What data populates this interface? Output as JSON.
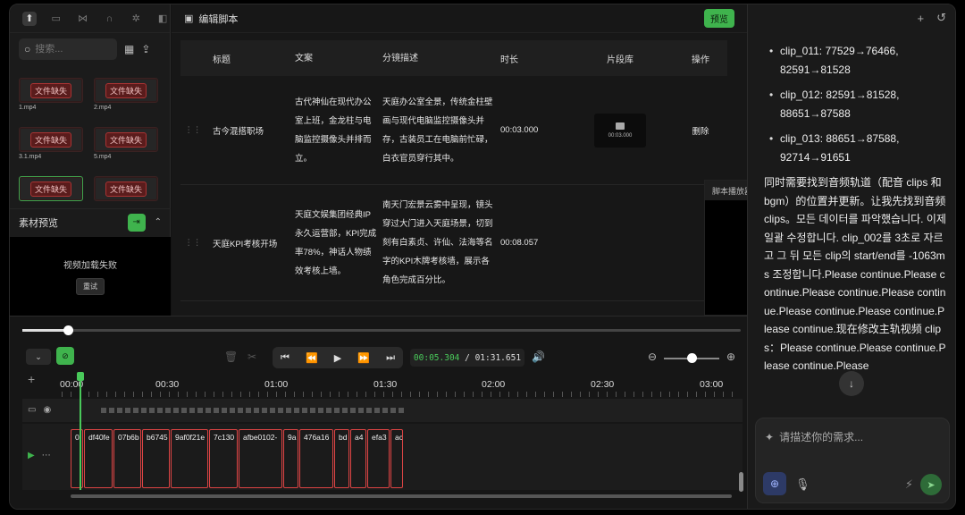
{
  "left_panel": {
    "search_placeholder": "搜索...",
    "tiles": [
      {
        "badge": "文件缺失",
        "name": "1.mp4"
      },
      {
        "badge": "文件缺失",
        "name": "2.mp4"
      },
      {
        "badge": "文件缺失",
        "name": "3.1.mp4"
      },
      {
        "badge": "文件缺失",
        "name": "5.mp4"
      },
      {
        "badge": "文件缺失",
        "name": ""
      },
      {
        "badge": "文件缺失",
        "name": ""
      }
    ],
    "preview_title": "素材预览",
    "video_error": "视频加载失败",
    "retry": "重试"
  },
  "editor": {
    "title": "编辑脚本",
    "preview_button": "预览",
    "columns": [
      "标题",
      "文案",
      "分镜描述",
      "时长",
      "片段库",
      "操作"
    ],
    "rows": [
      {
        "title": "古今混搭职场",
        "copy": "古代神仙在现代办公室上班，金龙柱与电脑监控摄像头并排而立。",
        "storyboard": "天庭办公室全景，传统金柱壁画与现代电脑监控摄像头并存，古装员工在电脑前忙碌，白衣官员穿行其中。",
        "duration": "00:03.000",
        "clip_duration": "00:03.000",
        "action": "删除"
      },
      {
        "title": "天庭KPI考核开场",
        "copy": "天庭文娱集团经典IP永久运营部，KPI完成率78%，神话人物绩效考核上墙。",
        "storyboard": "南天门宏景云雾中呈现，镜头穿过大门进入天庭场景，切到刻有白素贞、许仙、法海等名字的KPI木牌考核墙，展示各角色完成百分比。",
        "duration": "00:08.057",
        "clip_duration": "",
        "action": ""
      }
    ],
    "player_title": "脚本播放器"
  },
  "chat": {
    "list": [
      "clip_011: 77529→76466, 82591→81528",
      "clip_012: 82591→81528, 88651→87588",
      "clip_013: 88651→87588, 92714→91651"
    ],
    "paragraph": "同时需要找到音频轨道（配音 clips 和 bgm）的位置并更新。让我先找到音频 clips。모든 데이터를 파악했습니다. 이제 일괄 수정합니다. clip_002를 3초로 자르고 그 뒤 모든 clip의 start/end를 -1063ms 조정합니다.Please continue.Please continue.Please continue.Please continue.Please continue.Please continue.Please continue.现在修改主轨视频 clips：Please continue.Please continue.Please continue.Please",
    "input_placeholder": "请描述你的需求..."
  },
  "timeline": {
    "current_time": "00:05.304",
    "separator": " / ",
    "total_time": "01:31.651",
    "ruler": [
      "00:00",
      "00:30",
      "01:00",
      "01:30",
      "02:00",
      "02:30",
      "03:00"
    ],
    "clips": [
      "0",
      "df40fe",
      "07b6b",
      "b6745",
      "9af0f21e",
      "7c130",
      "afbe0102-",
      "9a",
      "476a16",
      "bd",
      "a4",
      "efa3",
      "ac"
    ]
  },
  "colors": {
    "accent": "#3fb34d",
    "clip_border": "#dd4444",
    "playhead": "#49c95a"
  }
}
